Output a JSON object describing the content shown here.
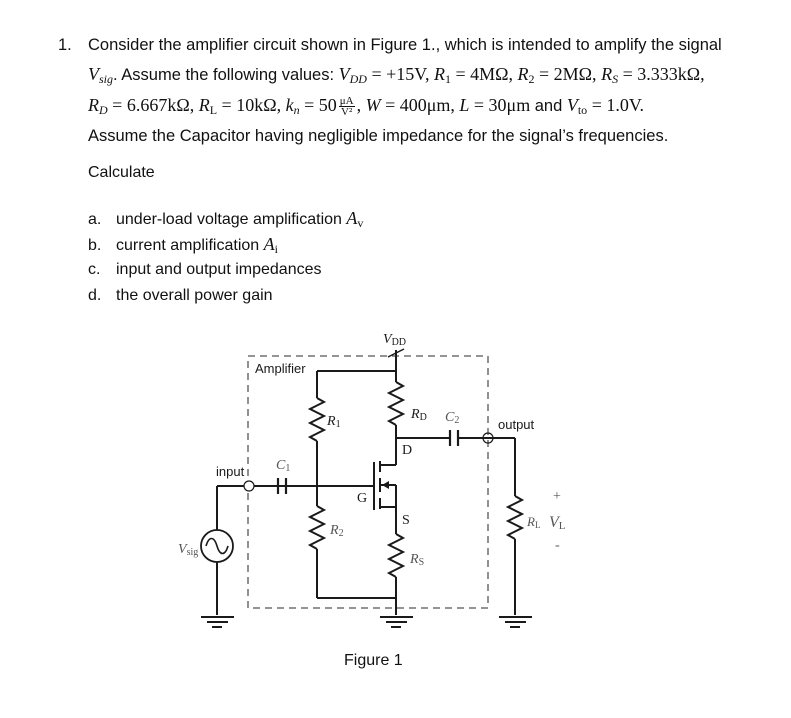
{
  "problem": {
    "number": "1.",
    "line1": "Consider the amplifier circuit shown in Figure 1., which is intended to amplify the signal",
    "line2_vsig": "V",
    "line2_vsig_sub": "sig",
    "line2_text": ". Assume the following values: ",
    "vdd_label": "V",
    "vdd_sub": "DD",
    "vdd_value": " = +15V, ",
    "r1_label": "R",
    "r1_sub": "1",
    "r1_value": " = 4MΩ, ",
    "r2_label": "R",
    "r2_sub": "2",
    "r2_value": " = 2MΩ, ",
    "rs_label": "R",
    "rs_sub": "S",
    "rs_value": " = 3.333kΩ,",
    "rd_label": "R",
    "rd_sub": "D",
    "rd_value": " = 6.667kΩ,  ",
    "rl_label": "R",
    "rl_sub": "L",
    "rl_value": " = 10kΩ,  ",
    "kn_label": "k",
    "kn_sub": "n",
    "kn_value": " = 50",
    "kn_unit_top": "μA",
    "kn_unit_bot": "V²",
    "w_label": "W",
    "w_value": " = 400μm,  ",
    "l_label": "L",
    "l_value": " = 30μm  ",
    "and_text": "and  ",
    "vto_label": "V",
    "vto_sub": "to",
    "vto_value": " = 1.0V.",
    "line4": "Assume the Capacitor having negligible impedance for the signal’s frequencies."
  },
  "calculate_heading": "Calculate",
  "tasks": [
    {
      "label": "a.",
      "text": "under-load voltage amplification ",
      "sym": "A",
      "sym_sub": "v"
    },
    {
      "label": "b.",
      "text": "current amplification ",
      "sym": "A",
      "sym_sub": "i"
    },
    {
      "label": "c.",
      "text": "input and output impedances",
      "sym": "",
      "sym_sub": ""
    },
    {
      "label": "d.",
      "text": "the overall power gain",
      "sym": "",
      "sym_sub": ""
    }
  ],
  "figure": {
    "caption": "Figure 1",
    "labels": {
      "vdd": "V",
      "vdd_sub": "DD",
      "amplifier": "Amplifier",
      "r1": "R",
      "r1_sub": "1",
      "rd": "R",
      "rd_sub": "D",
      "c2": "C",
      "c2_sub": "2",
      "output": "output",
      "d": "D",
      "input": "input",
      "c1": "C",
      "c1_sub": "1",
      "g": "G",
      "s": "S",
      "r2": "R",
      "r2_sub": "2",
      "rs": "R",
      "rs_sub": "S",
      "vsig": "V",
      "vsig_sub": "sig",
      "rl": "R",
      "rl_sub": "L",
      "vl": "V",
      "vl_sub": "L",
      "plus": "+",
      "minus": "-"
    }
  }
}
